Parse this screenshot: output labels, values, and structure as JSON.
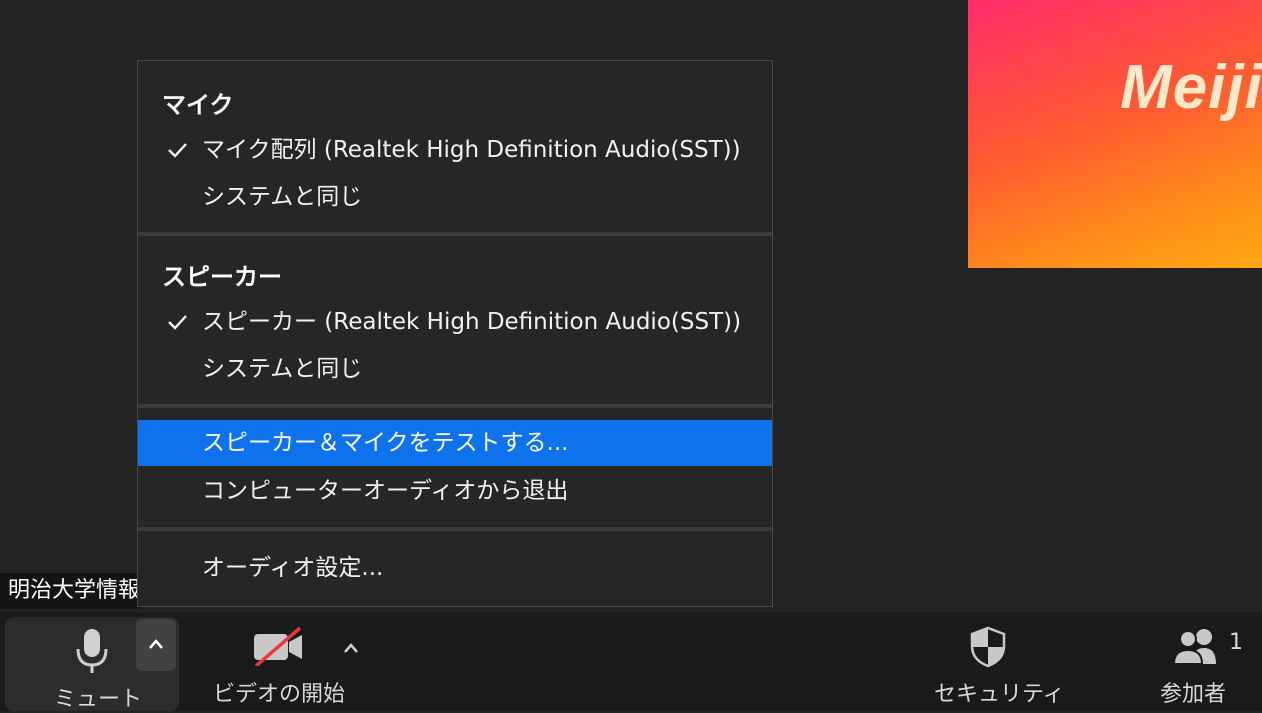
{
  "video_tile": {
    "logo_text": "Meiji"
  },
  "name_tag": "明治大学情報",
  "menu": {
    "mic_section": {
      "title": "マイク",
      "items": [
        {
          "label": "マイク配列 (Realtek High Definition Audio(SST))",
          "checked": true
        },
        {
          "label": "システムと同じ",
          "checked": false
        }
      ]
    },
    "speaker_section": {
      "title": "スピーカー",
      "items": [
        {
          "label": "スピーカー (Realtek High Definition Audio(SST))",
          "checked": true
        },
        {
          "label": "システムと同じ",
          "checked": false
        }
      ]
    },
    "actions": [
      {
        "label": "スピーカー＆マイクをテストする...",
        "highlighted": true
      },
      {
        "label": "コンピューターオーディオから退出",
        "highlighted": false
      }
    ],
    "settings": {
      "label": "オーディオ設定..."
    }
  },
  "toolbar": {
    "mute_label": "ミュート",
    "video_label": "ビデオの開始",
    "security_label": "セキュリティ",
    "participants_label": "参加者",
    "participants_count": "1"
  },
  "colors": {
    "highlight": "#0e72ed",
    "video_off_slash": "#e8383d",
    "menu_bg": "#262626",
    "toolbar_bg": "#1a1a1a"
  }
}
